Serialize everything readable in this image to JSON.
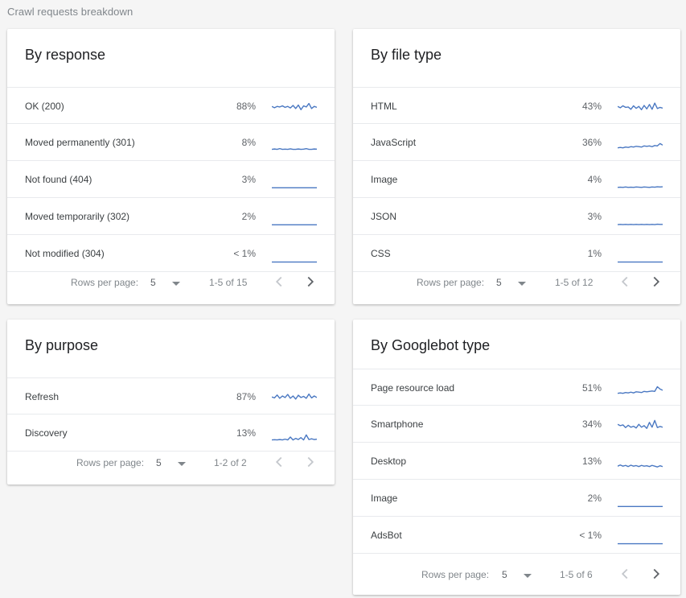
{
  "page": {
    "title": "Crawl requests breakdown"
  },
  "colors": {
    "sparkline": "#4a78c2",
    "disabled": "#c4c7cc",
    "enabled": "#5f6368"
  },
  "cards": {
    "response": {
      "title": "By response",
      "rows": [
        {
          "label": "OK (200)",
          "value": "88%",
          "trend": [
            0.55,
            0.62,
            0.55,
            0.58,
            0.52,
            0.6,
            0.55,
            0.63,
            0.5,
            0.66,
            0.48,
            0.72,
            0.52,
            0.58,
            0.4,
            0.66,
            0.55,
            0.6
          ]
        },
        {
          "label": "Moved permanently (301)",
          "value": "8%",
          "trend": [
            0.9,
            0.88,
            0.9,
            0.86,
            0.9,
            0.89,
            0.9,
            0.87,
            0.9,
            0.9,
            0.88,
            0.9,
            0.89,
            0.86,
            0.9,
            0.9,
            0.88,
            0.89
          ]
        },
        {
          "label": "Not found (404)",
          "value": "3%",
          "trend": [
            0.97,
            0.97,
            0.97,
            0.97,
            0.97,
            0.97,
            0.97,
            0.97,
            0.97,
            0.97,
            0.97,
            0.97,
            0.97,
            0.97,
            0.97,
            0.97,
            0.97,
            0.97
          ]
        },
        {
          "label": "Moved temporarily (302)",
          "value": "2%",
          "trend": [
            0.97,
            0.97,
            0.97,
            0.97,
            0.97,
            0.97,
            0.97,
            0.97,
            0.97,
            0.97,
            0.97,
            0.97,
            0.97,
            0.97,
            0.97,
            0.97,
            0.97,
            0.97
          ]
        },
        {
          "label": "Not modified (304)",
          "value": "< 1%",
          "trend": [
            0.98,
            0.98,
            0.98,
            0.98,
            0.98,
            0.98,
            0.98,
            0.98,
            0.98,
            0.98,
            0.98,
            0.98,
            0.98,
            0.98,
            0.98,
            0.98,
            0.98,
            0.98
          ]
        }
      ],
      "rows_per_page_label": "Rows per page:",
      "rows_per_page_value": "5",
      "range": "1-5 of 15",
      "prev_enabled": false,
      "next_enabled": true
    },
    "file_type": {
      "title": "By file type",
      "rows": [
        {
          "label": "HTML",
          "value": "43%",
          "trend": [
            0.55,
            0.62,
            0.52,
            0.6,
            0.58,
            0.7,
            0.52,
            0.65,
            0.55,
            0.72,
            0.5,
            0.68,
            0.45,
            0.7,
            0.38,
            0.66,
            0.6,
            0.64
          ]
        },
        {
          "label": "JavaScript",
          "value": "36%",
          "trend": [
            0.82,
            0.8,
            0.82,
            0.78,
            0.8,
            0.76,
            0.78,
            0.74,
            0.76,
            0.78,
            0.72,
            0.74,
            0.72,
            0.76,
            0.7,
            0.72,
            0.6,
            0.68
          ]
        },
        {
          "label": "Image",
          "value": "4%",
          "trend": [
            0.95,
            0.94,
            0.95,
            0.93,
            0.95,
            0.94,
            0.95,
            0.93,
            0.94,
            0.95,
            0.93,
            0.94,
            0.95,
            0.93,
            0.94,
            0.92,
            0.93,
            0.92
          ]
        },
        {
          "label": "JSON",
          "value": "3%",
          "trend": [
            0.96,
            0.95,
            0.96,
            0.95,
            0.96,
            0.95,
            0.96,
            0.95,
            0.96,
            0.95,
            0.96,
            0.95,
            0.96,
            0.95,
            0.96,
            0.94,
            0.95,
            0.95
          ]
        },
        {
          "label": "CSS",
          "value": "1%",
          "trend": [
            0.98,
            0.98,
            0.98,
            0.98,
            0.98,
            0.98,
            0.98,
            0.98,
            0.98,
            0.98,
            0.98,
            0.98,
            0.98,
            0.98,
            0.98,
            0.98,
            0.98,
            0.98
          ]
        }
      ],
      "rows_per_page_label": "Rows per page:",
      "rows_per_page_value": "5",
      "range": "1-5 of 12",
      "prev_enabled": false,
      "next_enabled": true
    },
    "purpose": {
      "title": "By purpose",
      "rows": [
        {
          "label": "Refresh",
          "value": "87%",
          "trend": [
            0.55,
            0.6,
            0.45,
            0.62,
            0.5,
            0.58,
            0.42,
            0.62,
            0.5,
            0.66,
            0.46,
            0.58,
            0.52,
            0.62,
            0.4,
            0.6,
            0.5,
            0.58
          ]
        },
        {
          "label": "Discovery",
          "value": "13%",
          "trend": [
            0.9,
            0.89,
            0.9,
            0.88,
            0.9,
            0.86,
            0.9,
            0.75,
            0.9,
            0.82,
            0.88,
            0.78,
            0.9,
            0.64,
            0.88,
            0.84,
            0.88,
            0.86
          ]
        }
      ],
      "rows_per_page_label": "Rows per page:",
      "rows_per_page_value": "5",
      "range": "1-2 of 2",
      "prev_enabled": false,
      "next_enabled": false
    },
    "googlebot": {
      "title": "By Googlebot type",
      "rows": [
        {
          "label": "Page resource load",
          "value": "51%",
          "trend": [
            0.82,
            0.8,
            0.82,
            0.78,
            0.8,
            0.76,
            0.8,
            0.74,
            0.76,
            0.78,
            0.72,
            0.74,
            0.72,
            0.7,
            0.72,
            0.48,
            0.6,
            0.66
          ]
        },
        {
          "label": "Smartphone",
          "value": "34%",
          "trend": [
            0.55,
            0.62,
            0.58,
            0.72,
            0.6,
            0.7,
            0.65,
            0.74,
            0.55,
            0.7,
            0.62,
            0.76,
            0.45,
            0.7,
            0.35,
            0.72,
            0.66,
            0.7
          ]
        },
        {
          "label": "Desktop",
          "value": "13%",
          "trend": [
            0.8,
            0.74,
            0.8,
            0.76,
            0.82,
            0.75,
            0.8,
            0.77,
            0.82,
            0.76,
            0.8,
            0.78,
            0.82,
            0.76,
            0.8,
            0.84,
            0.78,
            0.82
          ]
        },
        {
          "label": "Image",
          "value": "2%",
          "trend": [
            0.97,
            0.97,
            0.97,
            0.97,
            0.97,
            0.97,
            0.97,
            0.97,
            0.97,
            0.97,
            0.97,
            0.97,
            0.97,
            0.97,
            0.97,
            0.97,
            0.97,
            0.97
          ]
        },
        {
          "label": "AdsBot",
          "value": "< 1%",
          "trend": [
            0.98,
            0.98,
            0.98,
            0.98,
            0.98,
            0.98,
            0.98,
            0.98,
            0.98,
            0.98,
            0.98,
            0.98,
            0.98,
            0.98,
            0.98,
            0.98,
            0.98,
            0.98
          ]
        }
      ],
      "rows_per_page_label": "Rows per page:",
      "rows_per_page_value": "5",
      "range": "1-5 of 6",
      "prev_enabled": false,
      "next_enabled": true
    }
  }
}
